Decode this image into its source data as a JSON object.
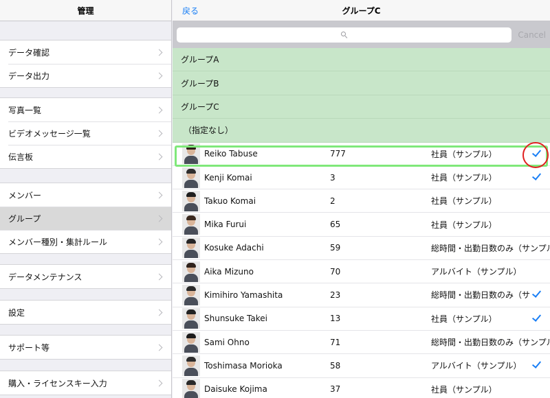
{
  "left": {
    "title": "管理",
    "groups": [
      [
        "データ確認",
        "データ出力"
      ],
      [
        "写真一覧",
        "ビデオメッセージ一覧",
        "伝言板"
      ],
      [
        "メンバー",
        "グループ",
        "メンバー種別・集計ルール"
      ],
      [
        "データメンテナンス"
      ],
      [
        "設定"
      ],
      [
        "サポート等"
      ],
      [
        "購入・ライセンスキー入力"
      ]
    ],
    "selected": "グループ"
  },
  "right": {
    "back_label": "戻る",
    "title": "グループC",
    "search": {
      "placeholder": "",
      "cancel_label": "Cancel"
    },
    "groups": [
      "グループA",
      "グループB",
      "グループC",
      "（指定なし）"
    ],
    "members": [
      {
        "name": "Reiko Tabuse",
        "number": "777",
        "role": "社員（サンプル）",
        "checked": true
      },
      {
        "name": "Kenji Komai",
        "number": "3",
        "role": "社員（サンプル）",
        "checked": true
      },
      {
        "name": "Takuo Komai",
        "number": "2",
        "role": "社員（サンプル）",
        "checked": false
      },
      {
        "name": "Mika Furui",
        "number": "65",
        "role": "社員（サンプル）",
        "checked": false
      },
      {
        "name": "Kosuke Adachi",
        "number": "59",
        "role": "総時間・出勤日数のみ（サンプル",
        "checked": false
      },
      {
        "name": "Aika Mizuno",
        "number": "70",
        "role": "アルバイト（サンプル）",
        "checked": false
      },
      {
        "name": "Kimihiro Yamashita",
        "number": "23",
        "role": "総時間・出勤日数のみ（サ",
        "checked": true
      },
      {
        "name": "Shunsuke Takei",
        "number": "13",
        "role": "社員（サンプル）",
        "checked": true
      },
      {
        "name": "Sami Ohno",
        "number": "71",
        "role": "総時間・出勤日数のみ（サンプル",
        "checked": false
      },
      {
        "name": "Toshimasa Morioka",
        "number": "58",
        "role": "アルバイト（サンプル）",
        "checked": true
      },
      {
        "name": "Daisuke Kojima",
        "number": "37",
        "role": "社員（サンプル）",
        "checked": false
      }
    ]
  },
  "colors": {
    "accent": "#1a7ff5",
    "group_row_bg": "#c8e6c9",
    "highlight_frame": "#7fe87a",
    "annotation_circle": "#e02020"
  }
}
